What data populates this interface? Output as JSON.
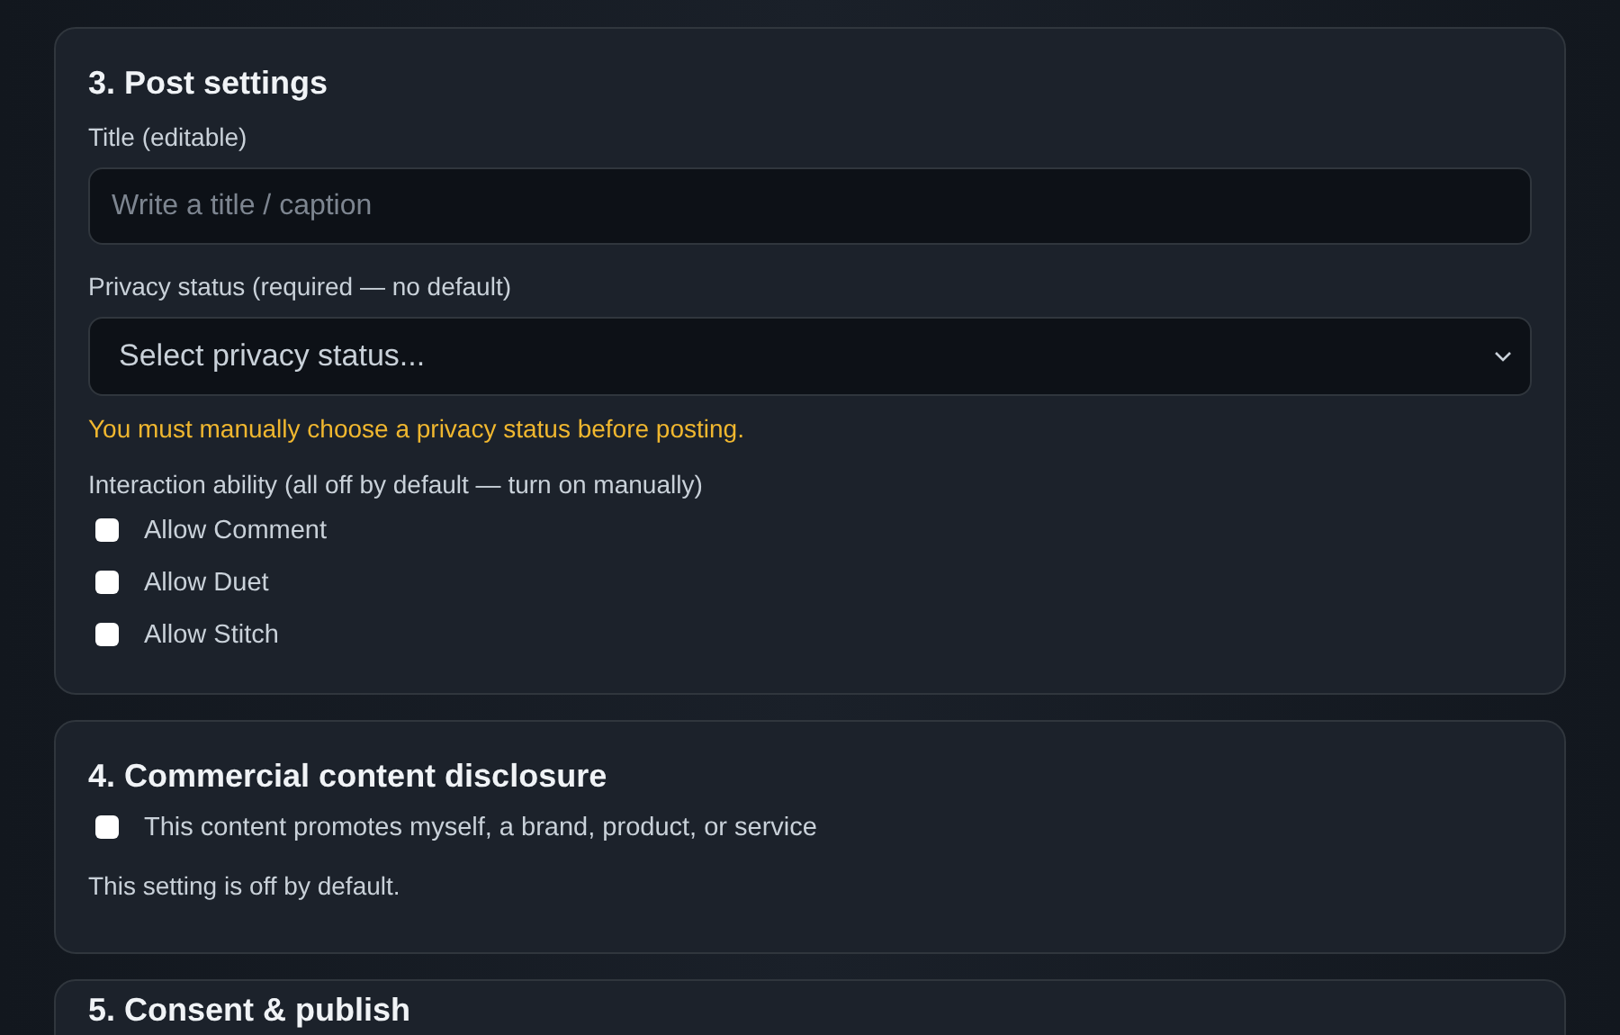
{
  "sections": [
    {
      "kind": "post",
      "title": "3. Post settings",
      "title_label": "Title (editable)",
      "title_placeholder": "Write a title / caption",
      "privacy_label": "Privacy status (required — no default)",
      "privacy_placeholder": "Select privacy status...",
      "warning": "You must manually choose a privacy status before posting.",
      "interaction_label": "Interaction ability (all off by default — turn on manually)",
      "options": [
        {
          "label": "Allow Comment",
          "checked": false
        },
        {
          "label": "Allow Duet",
          "checked": false
        },
        {
          "label": "Allow Stitch",
          "checked": false
        }
      ]
    },
    {
      "kind": "disclosure",
      "title": "4. Commercial content disclosure",
      "options": [
        {
          "label": "This content promotes myself, a brand, product, or service",
          "checked": false
        }
      ],
      "note": "This setting is off by default."
    },
    {
      "kind": "heading",
      "title": "5. Consent & publish"
    }
  ]
}
